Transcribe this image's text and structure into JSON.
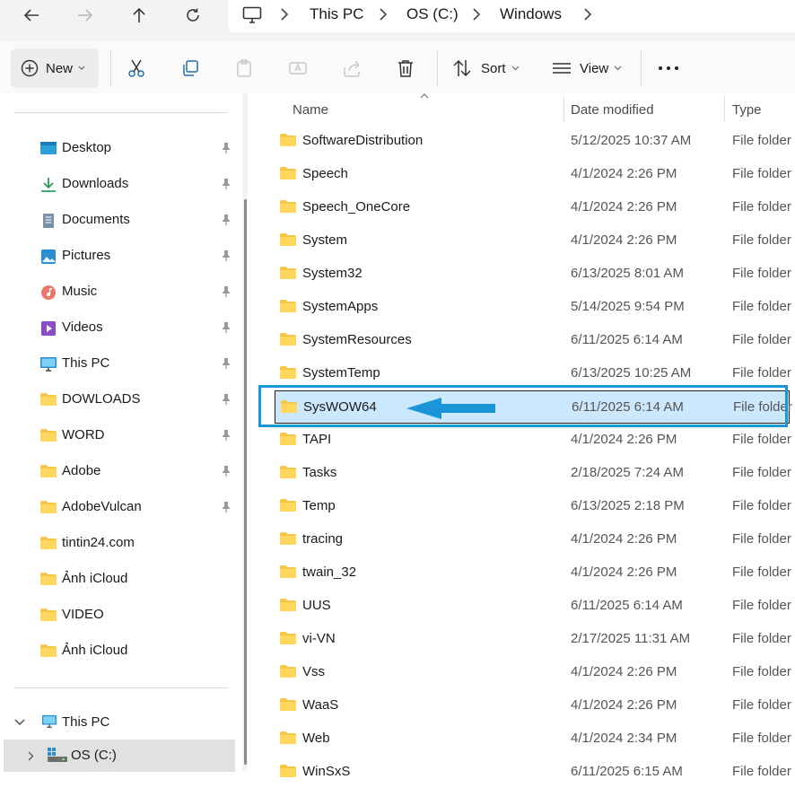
{
  "breadcrumb": [
    "This PC",
    "OS (C:)",
    "Windows"
  ],
  "toolbar": {
    "new_label": "New",
    "sort_label": "Sort",
    "view_label": "View"
  },
  "sidebar": {
    "quick_access": [
      {
        "label": "Desktop",
        "icon": "desktop-icon",
        "pinned": true
      },
      {
        "label": "Downloads",
        "icon": "downloads-icon",
        "pinned": true
      },
      {
        "label": "Documents",
        "icon": "documents-icon",
        "pinned": true
      },
      {
        "label": "Pictures",
        "icon": "pictures-icon",
        "pinned": true
      },
      {
        "label": "Music",
        "icon": "music-icon",
        "pinned": true
      },
      {
        "label": "Videos",
        "icon": "videos-icon",
        "pinned": true
      },
      {
        "label": "This PC",
        "icon": "monitor-icon",
        "pinned": true
      },
      {
        "label": "DOWLOADS",
        "icon": "folder-icon",
        "pinned": true
      },
      {
        "label": "WORD",
        "icon": "folder-icon",
        "pinned": true
      },
      {
        "label": "Adobe",
        "icon": "folder-icon",
        "pinned": true
      },
      {
        "label": "AdobeVulcan",
        "icon": "folder-icon",
        "pinned": true
      },
      {
        "label": "tintin24.com",
        "icon": "folder-icon",
        "pinned": false
      },
      {
        "label": "Ảnh iCloud",
        "icon": "folder-icon",
        "pinned": false
      },
      {
        "label": "VIDEO",
        "icon": "folder-icon",
        "pinned": false
      },
      {
        "label": "Ảnh iCloud",
        "icon": "folder-icon",
        "pinned": false
      }
    ],
    "this_pc_label": "This PC",
    "drive_label": "OS (C:)"
  },
  "columns": {
    "name": "Name",
    "date": "Date modified",
    "type": "Type"
  },
  "files": [
    {
      "name": "SoftwareDistribution",
      "date": "5/12/2025 10:37 AM",
      "type": "File folder"
    },
    {
      "name": "Speech",
      "date": "4/1/2024 2:26 PM",
      "type": "File folder"
    },
    {
      "name": "Speech_OneCore",
      "date": "4/1/2024 2:26 PM",
      "type": "File folder"
    },
    {
      "name": "System",
      "date": "4/1/2024 2:26 PM",
      "type": "File folder"
    },
    {
      "name": "System32",
      "date": "6/13/2025 8:01 AM",
      "type": "File folder"
    },
    {
      "name": "SystemApps",
      "date": "5/14/2025 9:54 PM",
      "type": "File folder"
    },
    {
      "name": "SystemResources",
      "date": "6/11/2025 6:14 AM",
      "type": "File folder"
    },
    {
      "name": "SystemTemp",
      "date": "6/13/2025 10:25 AM",
      "type": "File folder"
    },
    {
      "name": "SysWOW64",
      "date": "6/11/2025 6:14 AM",
      "type": "File folder"
    },
    {
      "name": "TAPI",
      "date": "4/1/2024 2:26 PM",
      "type": "File folder"
    },
    {
      "name": "Tasks",
      "date": "2/18/2025 7:24 AM",
      "type": "File folder"
    },
    {
      "name": "Temp",
      "date": "6/13/2025 2:18 PM",
      "type": "File folder"
    },
    {
      "name": "tracing",
      "date": "4/1/2024 2:26 PM",
      "type": "File folder"
    },
    {
      "name": "twain_32",
      "date": "4/1/2024 2:26 PM",
      "type": "File folder"
    },
    {
      "name": "UUS",
      "date": "6/11/2025 6:14 AM",
      "type": "File folder"
    },
    {
      "name": "vi-VN",
      "date": "2/17/2025 11:31 AM",
      "type": "File folder"
    },
    {
      "name": "Vss",
      "date": "4/1/2024 2:26 PM",
      "type": "File folder"
    },
    {
      "name": "WaaS",
      "date": "4/1/2024 2:26 PM",
      "type": "File folder"
    },
    {
      "name": "Web",
      "date": "4/1/2024 2:34 PM",
      "type": "File folder"
    },
    {
      "name": "WinSxS",
      "date": "6/11/2025 6:15 AM",
      "type": "File folder"
    }
  ],
  "selected_file": "SysWOW64",
  "colors": {
    "selection": "#cce8ff",
    "annotation": "#1a96d8",
    "folder": "#f6c744"
  }
}
